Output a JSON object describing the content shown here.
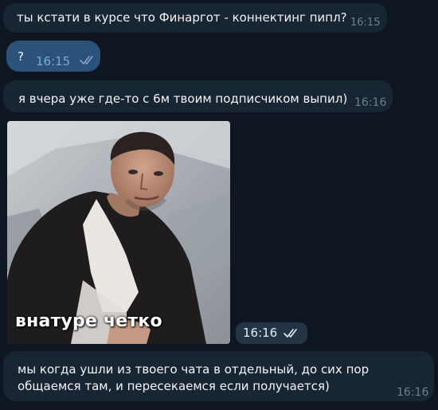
{
  "messages": [
    {
      "direction": "incoming",
      "text": "ты кстати в курсе что Финаргот - коннектинг пипл?",
      "time": "16:15"
    },
    {
      "direction": "outgoing",
      "text": "?",
      "time": "16:15",
      "status": "read"
    },
    {
      "direction": "incoming",
      "text": "я вчера уже где-то с 6м твоим подписчиком выпил)",
      "time": "16:16"
    },
    {
      "direction": "incoming",
      "type": "sticker",
      "caption": "внатуре четко",
      "time": "16:16",
      "status": "read"
    },
    {
      "direction": "incoming",
      "text": "мы когда ушли из твоего чата в отдельный, до сих пор общаемся там, и пересекаемся если получается)",
      "time": "16:16"
    }
  ],
  "colors": {
    "background": "#0e1621",
    "incoming_bubble": "#182533",
    "outgoing_bubble": "#2b5278",
    "read_ticks": "#7da8d3"
  },
  "icons": {
    "read_status": "double-check-icon"
  }
}
